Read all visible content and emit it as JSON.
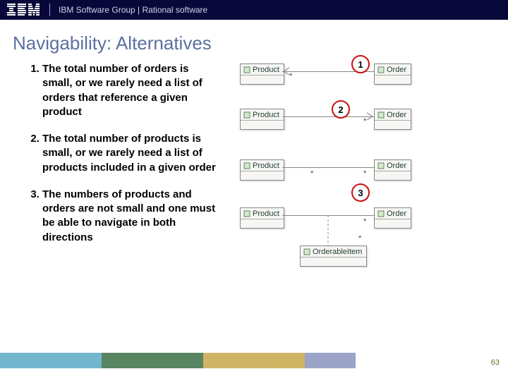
{
  "header": {
    "logo_alt": "IBM",
    "group_text": "IBM Software Group | Rational software"
  },
  "title": "Navigability: Alternatives",
  "bullets": [
    "The total number of orders is small, or we rarely need a list of orders that reference a given product",
    "The total number of products is small, or we rarely need a list of products included in a given order",
    "The numbers of products and orders are not small and one must be able to navigate in both directions"
  ],
  "uml": {
    "class_product": "Product",
    "class_order": "Order",
    "class_orderable": "OrderableItem",
    "mult_star": "*"
  },
  "badges": {
    "one": "1",
    "two": "2",
    "three": "3"
  },
  "page_number": "63"
}
